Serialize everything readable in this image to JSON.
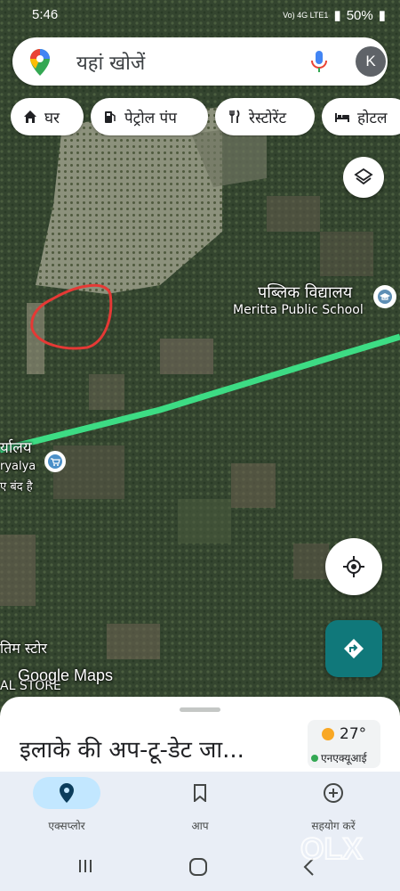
{
  "status_bar": {
    "time": "5:46",
    "network": "Vo) 4G LTE1",
    "battery": "50%"
  },
  "search": {
    "placeholder": "यहां खोजें",
    "account_initial": "K"
  },
  "chips": [
    {
      "label": "घर",
      "icon": "home-icon"
    },
    {
      "label": "पेट्रोल पंप",
      "icon": "gas-pump-icon"
    },
    {
      "label": "रेस्टोरेंट",
      "icon": "fork-knife-icon"
    },
    {
      "label": "होटल",
      "icon": "bed-icon"
    }
  ],
  "map_labels": {
    "school_hindi": "पब्लिक विद्यालय",
    "school_english": "Meritta Public School",
    "store_left_1": "र्यालय",
    "store_left_2": "ryalya",
    "store_left_3": "ए बंद है",
    "store_left_4": "तिम स्टोर",
    "store_left_5": "AL STORE",
    "google_maps": "Google Maps"
  },
  "sheet": {
    "title": "इलाके की अप-टू-डेट जा...",
    "temperature": "27°",
    "aqi_label": "एनएक्यूआई"
  },
  "bottom_nav": [
    {
      "label": "एक्सप्लोर",
      "icon": "explore-pin-icon",
      "active": true
    },
    {
      "label": "आप",
      "icon": "bookmark-icon",
      "active": false
    },
    {
      "label": "सहयोग करें",
      "icon": "add-circle-icon",
      "active": false
    }
  ],
  "watermark": "OLX",
  "colors": {
    "route": "#3ddc84",
    "directions_button": "#10787a",
    "active_nav_pill": "#c2e7ff",
    "drawn_circle": "#e53935"
  }
}
